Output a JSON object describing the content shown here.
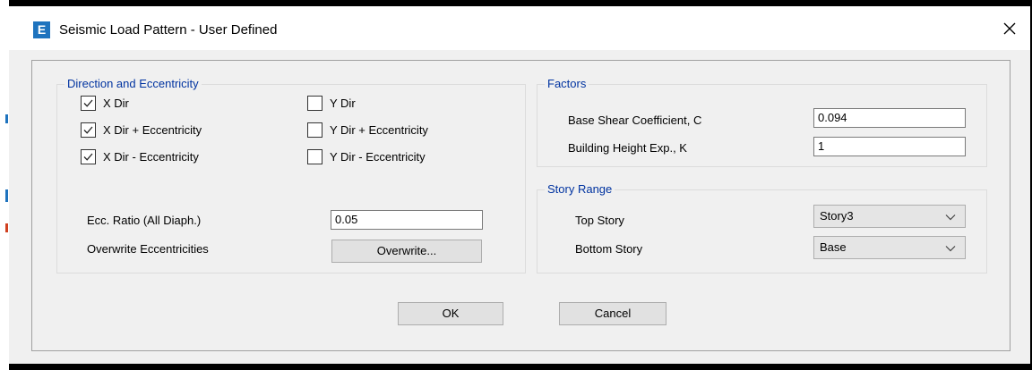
{
  "window": {
    "title": "Seismic Load Pattern - User Defined",
    "app_icon_letter": "E"
  },
  "direction_group": {
    "title": "Direction and Eccentricity",
    "checkboxes": [
      {
        "label": "X Dir",
        "checked": true
      },
      {
        "label": "X Dir + Eccentricity",
        "checked": true
      },
      {
        "label": "X Dir - Eccentricity",
        "checked": true
      },
      {
        "label": "Y Dir",
        "checked": false
      },
      {
        "label": "Y Dir + Eccentricity",
        "checked": false
      },
      {
        "label": "Y Dir - Eccentricity",
        "checked": false
      }
    ],
    "ecc_ratio_label": "Ecc. Ratio (All Diaph.)",
    "ecc_ratio_value": "0.05",
    "overwrite_label": "Overwrite Eccentricities",
    "overwrite_button": "Overwrite..."
  },
  "factors_group": {
    "title": "Factors",
    "base_shear_label": "Base Shear Coefficient, C",
    "base_shear_value": "0.094",
    "height_exp_label": "Building Height Exp., K",
    "height_exp_value": "1"
  },
  "story_range_group": {
    "title": "Story Range",
    "top_story_label": "Top Story",
    "top_story_value": "Story3",
    "bottom_story_label": "Bottom Story",
    "bottom_story_value": "Base"
  },
  "buttons": {
    "ok": "OK",
    "cancel": "Cancel"
  },
  "colors": {
    "group_title": "#0033a0",
    "app_icon": "#1e73be"
  }
}
